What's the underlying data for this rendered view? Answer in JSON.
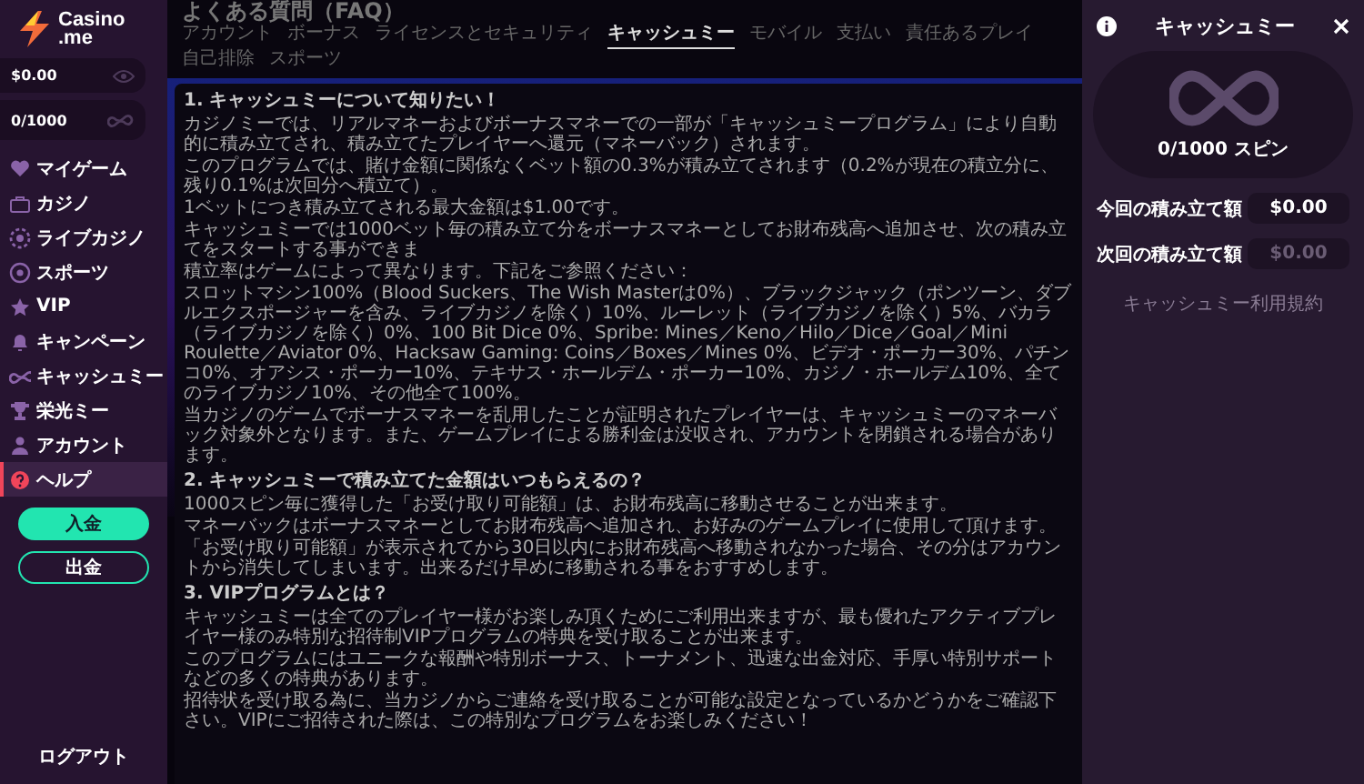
{
  "sidebar": {
    "logo": "Casino\n.me",
    "balance": "$0.00",
    "spins": "0/1000",
    "items": [
      {
        "label": "マイゲーム",
        "selected": false
      },
      {
        "label": "カジノ",
        "selected": false
      },
      {
        "label": "ライブカジノ",
        "selected": false
      },
      {
        "label": "スポーツ",
        "selected": false
      },
      {
        "label": "VIP",
        "selected": false
      },
      {
        "label": "キャンペーン",
        "selected": false
      },
      {
        "label": "キャッシュミー",
        "selected": false
      },
      {
        "label": "栄光ミー",
        "selected": false
      },
      {
        "label": "アカウント",
        "selected": false
      },
      {
        "label": "ヘルプ",
        "selected": true
      }
    ],
    "deposit": "入金",
    "withdraw": "出金",
    "logout": "ログアウト"
  },
  "page": {
    "title": "よくある質問（FAQ）",
    "tabs": [
      {
        "label": "アカウント",
        "selected": false
      },
      {
        "label": "ボーナス",
        "selected": false
      },
      {
        "label": "ライセンスとセキュリティ",
        "selected": false
      },
      {
        "label": "キャッシュミー",
        "selected": true
      },
      {
        "label": "モバイル",
        "selected": false
      },
      {
        "label": "支払い",
        "selected": false
      },
      {
        "label": "責任あるプレイ",
        "selected": false
      },
      {
        "label": "自己排除",
        "selected": false
      },
      {
        "label": "スポーツ",
        "selected": false
      }
    ],
    "sections": [
      {
        "heading": "1. キャッシュミーについて知りたい！",
        "paragraphs": [
          "カジノミーでは、リアルマネーおよびボーナスマネーでの一部が「キャッシュミープログラム」により自動的に積み立てされ、積み立てたプレイヤーへ還元（マネーバック）されます。",
          "このプログラムでは、賭け金額に関係なくベット額の0.3%が積み立てされます（0.2%が現在の積立分に、残り0.1%は次回分へ積立て）。",
          "1ベットにつき積み立てされる最大金額は$1.00です。",
          "キャッシュミーでは1000ベット毎の積み立て分をボーナスマネーとしてお財布残高へ追加させ、次の積み立てをスタートする事ができま",
          "積立率はゲームによって異なります。下記をご参照ください：",
          "スロットマシン100%（Blood Suckers、The Wish Masterは0%）、ブラックジャック（ポンツーン、ダブルエクスポージャーを含み、ライブカジノを除く）10%、ルーレット（ライブカジノを除く）5%、バカラ（ライブカジノを除く）0%、100 Bit Dice 0%、Spribe: Mines／Keno／Hilo／Dice／Goal／Mini Roulette／Aviator 0%、Hacksaw Gaming: Coins／Boxes／Mines 0%、ビデオ・ポーカー30%、パチンコ0%、オアシス・ポーカー10%、テキサス・ホールデム・ポーカー10%、カジノ・ホールデム10%、全てのライブカジノ10%、その他全て100%。",
          "当カジノのゲームでボーナスマネーを乱用したことが証明されたプレイヤーは、キャッシュミーのマネーバック対象外となります。また、ゲームプレイによる勝利金は没収され、アカウントを閉鎖される場合があります。"
        ]
      },
      {
        "heading": "2. キャッシュミーで積み立てた金額はいつもらえるの？",
        "paragraphs": [
          "1000スピン毎に獲得した「お受け取り可能額」は、お財布残高に移動させることが出来ます。",
          "マネーバックはボーナスマネーとしてお財布残高へ追加され、お好みのゲームプレイに使用して頂けます。",
          "「お受け取り可能額」が表示されてから30日以内にお財布残高へ移動されなかった場合、その分はアカウントから消失してしまいます。出来るだけ早めに移動される事をおすすめします。"
        ]
      },
      {
        "heading": "3. VIPプログラムとは？",
        "paragraphs": [
          "キャッシュミーは全てのプレイヤー様がお楽しみ頂くためにご利用出来ますが、最も優れたアクティブプレイヤー様のみ特別な招待制VIPプログラムの特典を受け取ることが出来ます。",
          "このプログラムにはユニークな報酬や特別ボーナス、トーナメント、迅速な出金対応、手厚い特別サポートなどの多くの特典があります。",
          "招待状を受け取る為に、当カジノからご連絡を受け取ることが可能な設定となっているかどうかをご確認下さい。VIPにご招待された際は、この特別なプログラムをお楽しみください！"
        ]
      }
    ]
  },
  "panel": {
    "title": "キャッシュミー",
    "spins": "0/1000 スピン",
    "rows": [
      {
        "label": "今回の積み立て額",
        "value": "$0.00",
        "disabled": false
      },
      {
        "label": "次回の積み立て額",
        "value": "$0.00",
        "disabled": true
      }
    ],
    "terms_link": "キャッシュミー利用規約"
  }
}
